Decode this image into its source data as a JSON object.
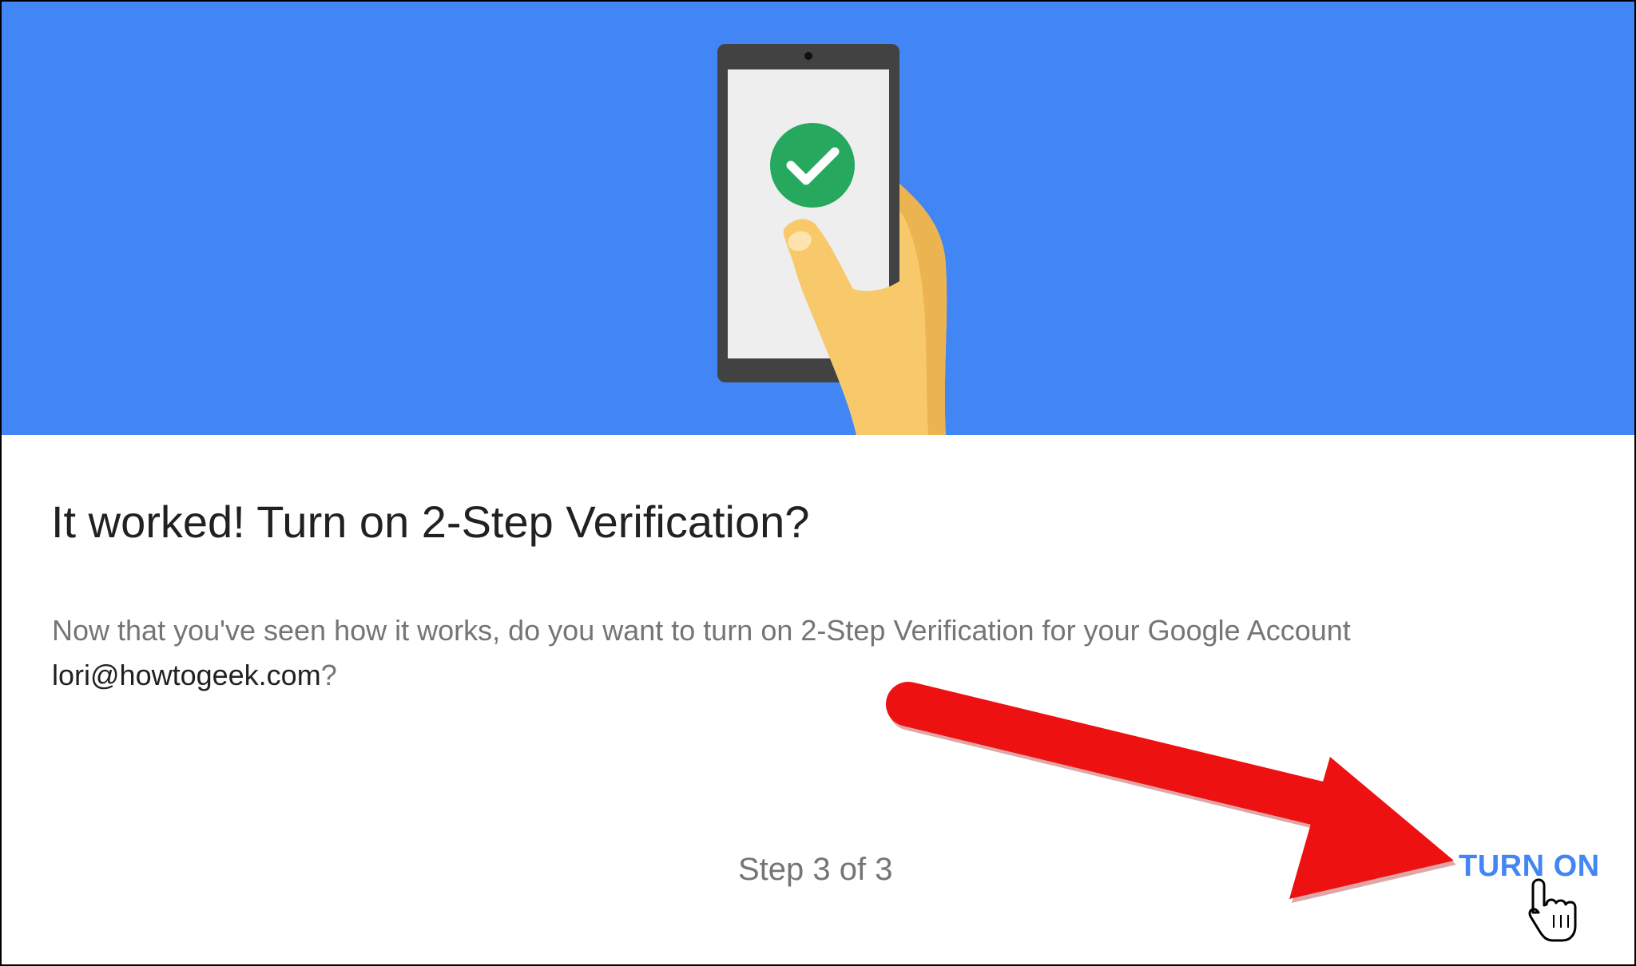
{
  "dialog": {
    "title": "It worked! Turn on 2-Step Verification?",
    "body_text": "Now that you've seen how it works, do you want to turn on 2-Step Verification for your Google Account",
    "account_email": "lori@howtogeek.com",
    "body_suffix": "?",
    "step_indicator": "Step 3 of 3",
    "turn_on_label": "TURN ON"
  },
  "hero": {
    "background_color": "#4285f4",
    "illustration": "hand-holding-phone-with-check",
    "check_color": "#27a85f"
  },
  "annotation": {
    "arrow_color": "#ee1111",
    "cursor": "hand-pointer-cursor"
  }
}
